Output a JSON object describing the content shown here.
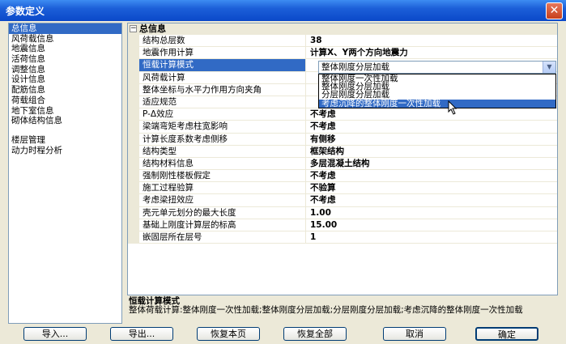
{
  "window": {
    "title": "参数定义",
    "close": "✕"
  },
  "left_panel": {
    "items": [
      "总信息",
      "风荷载信息",
      "地震信息",
      "活荷信息",
      "调整信息",
      "设计信息",
      "配筋信息",
      "荷载组合",
      "地下室信息",
      "砌体结构信息"
    ],
    "items_group2": [
      "楼层管理",
      "动力时程分析"
    ],
    "selected": "总信息"
  },
  "grid": {
    "category": "总信息",
    "rows": [
      {
        "name": "结构总层数",
        "value": "38"
      },
      {
        "name": "地震作用计算",
        "value": "计算X、Y两个方向地震力"
      },
      {
        "name": "恒载计算模式",
        "value": ""
      },
      {
        "name": "风荷载计算",
        "value": ""
      },
      {
        "name": "整体坐标与水平力作用方向夹角",
        "value": ""
      },
      {
        "name": "适应规范",
        "value": ""
      },
      {
        "name": "P-Δ效应",
        "value": "不考虑"
      },
      {
        "name": "梁端弯矩考虑柱宽影响",
        "value": "不考虑"
      },
      {
        "name": "计算长度系数考虑侧移",
        "value": "有侧移"
      },
      {
        "name": "结构类型",
        "value": "框架结构"
      },
      {
        "name": "结构材料信息",
        "value": "多层混凝土结构"
      },
      {
        "name": "强制刚性楼板假定",
        "value": "不考虑"
      },
      {
        "name": "施工过程验算",
        "value": "不验算"
      },
      {
        "name": "考虑梁扭效应",
        "value": "不考虑"
      },
      {
        "name": "壳元单元划分的最大长度",
        "value": "1.00"
      },
      {
        "name": "基础上刚度计算层的标高",
        "value": "15.00"
      },
      {
        "name": "嵌固层所在层号",
        "value": "1"
      }
    ]
  },
  "dropdown": {
    "selected": "整体刚度分层加载",
    "options": [
      "整体刚度一次性加载",
      "整体刚度分层加载",
      "分层刚度分层加载",
      "考虑沉降的整体刚度一次性加载"
    ],
    "hover_index": 3
  },
  "description": {
    "title": "恒载计算模式",
    "text": "整体荷载计算:整体刚度一次性加载;整体刚度分层加载;分层刚度分层加载;考虑沉降的整体刚度一次性加载"
  },
  "buttons": {
    "import": "导入...",
    "export": "导出...",
    "restore_page": "恢复本页",
    "restore_all": "恢复全部",
    "cancel": "取消",
    "ok": "确定"
  },
  "colors": {
    "selection": "#316ac5",
    "titlebar": "#0a48c9",
    "face": "#ece9d8"
  }
}
